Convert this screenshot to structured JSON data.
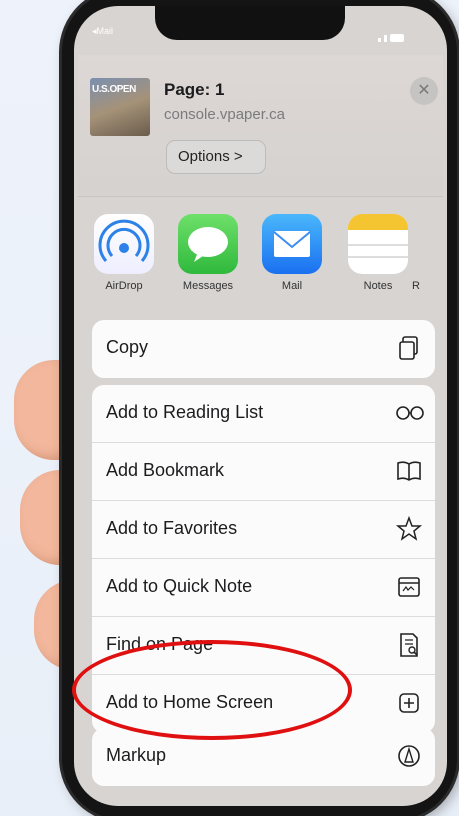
{
  "status": {
    "carrier": "◂Mail"
  },
  "header": {
    "thumb_title": "U.S.OPEN",
    "title": "Page: 1",
    "url": "console.vpaper.ca",
    "options": "Options >"
  },
  "apps": [
    {
      "label": "AirDrop",
      "icon": "airdrop-icon"
    },
    {
      "label": "Messages",
      "icon": "messages-icon"
    },
    {
      "label": "Mail",
      "icon": "mail-icon"
    },
    {
      "label": "Notes",
      "icon": "notes-icon"
    },
    {
      "label": "R",
      "icon": "reminders-icon"
    }
  ],
  "actions_top": [
    {
      "label": "Copy",
      "icon": "copy-icon"
    }
  ],
  "actions": [
    {
      "label": "Add to Reading List",
      "icon": "glasses-icon"
    },
    {
      "label": "Add Bookmark",
      "icon": "book-icon"
    },
    {
      "label": "Add to Favorites",
      "icon": "star-icon"
    },
    {
      "label": "Add to Quick Note",
      "icon": "quick-note-icon"
    },
    {
      "label": "Find on Page",
      "icon": "find-document-icon"
    },
    {
      "label": "Add to Home Screen",
      "icon": "plus-square-icon"
    }
  ],
  "actions_bottom": [
    {
      "label": "Markup",
      "icon": "markup-icon"
    }
  ],
  "colors": {
    "highlight": "#e01010",
    "sheet": "#fbfbfb"
  }
}
